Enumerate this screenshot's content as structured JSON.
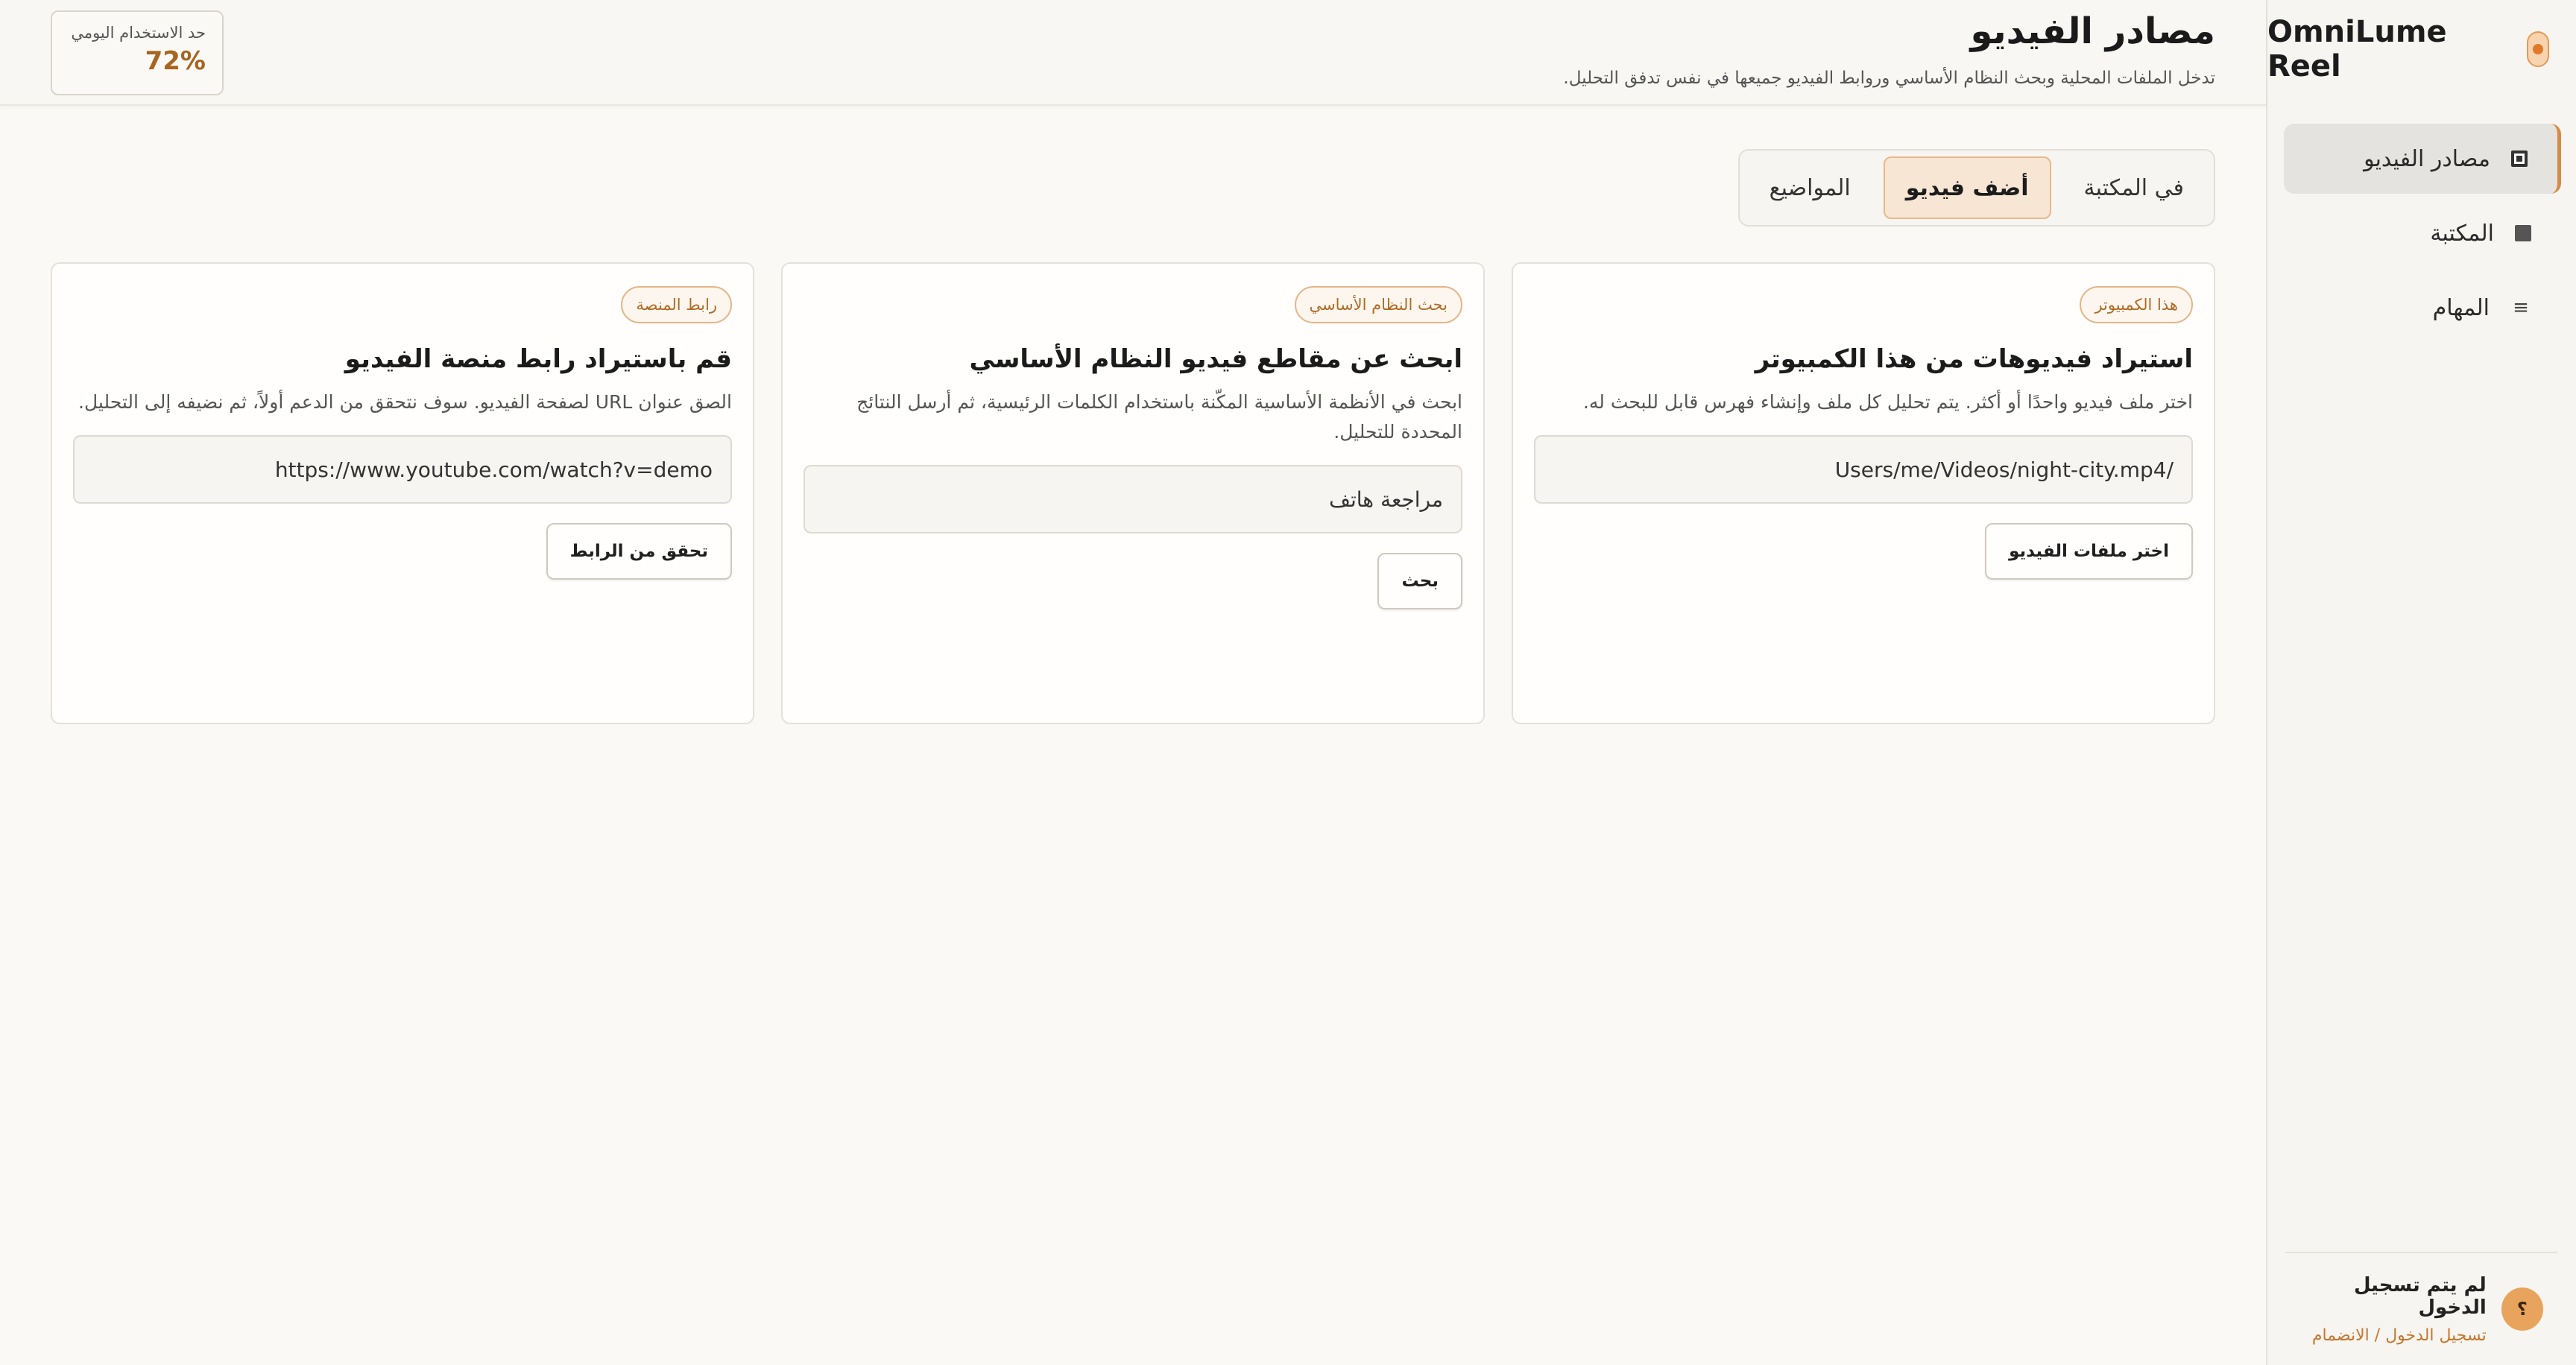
{
  "sidebar": {
    "brand": "OmniLume Reel",
    "items": [
      {
        "label": "مصادر الفيديو",
        "icon": "square-outline-icon",
        "active": true
      },
      {
        "label": "المكتبة",
        "icon": "square-icon"
      },
      {
        "label": "المهام",
        "icon": "list-icon"
      }
    ],
    "footer": {
      "avatar": "؟",
      "status": "لم يتم تسجيل الدخول",
      "link": "تسجيل الدخول / الانضمام"
    }
  },
  "header": {
    "title": "مصادر الفيديو",
    "subtitle": "تدخل الملفات المحلية وبحث النظام الأساسي وروابط الفيديو جميعها في نفس تدفق التحليل.",
    "quota_label": "حد الاستخدام اليومي",
    "quota_value": "72%"
  },
  "tabs": [
    {
      "label": "في المكتبة"
    },
    {
      "label": "أضف فيديو",
      "active": true
    },
    {
      "label": "المواضيع"
    }
  ],
  "cards": [
    {
      "badge": "هذا الكمبيوتر",
      "title": "استيراد فيديوهات من هذا الكمبيوتر",
      "desc": "اختر ملف فيديو واحدًا أو أكثر. يتم تحليل كل ملف وإنشاء فهرس قابل للبحث له.",
      "input_value": "/Users/me/Videos/night-city.mp4",
      "button": "اختر ملفات الفيديو"
    },
    {
      "badge": "بحث النظام الأساسي",
      "title": "ابحث عن مقاطع فيديو النظام الأساسي",
      "desc": "ابحث في الأنظمة الأساسية المكّنة باستخدام الكلمات الرئيسية، ثم أرسل النتائج المحددة للتحليل.",
      "input_value": "مراجعة هاتف",
      "button": "بحث"
    },
    {
      "badge": "رابط المنصة",
      "title": "قم باستيراد رابط منصة الفيديو",
      "desc": "الصق عنوان URL لصفحة الفيديو. سوف نتحقق من الدعم أولاً، ثم نضيفه إلى التحليل.",
      "input_value": "https://www.youtube.com/watch?v=demo",
      "button": "تحقق من الرابط"
    }
  ],
  "colors": {
    "accent": "#d98a45",
    "accent_text": "#b06a23",
    "quota": "#a7651f",
    "background": "#faf9f6"
  }
}
